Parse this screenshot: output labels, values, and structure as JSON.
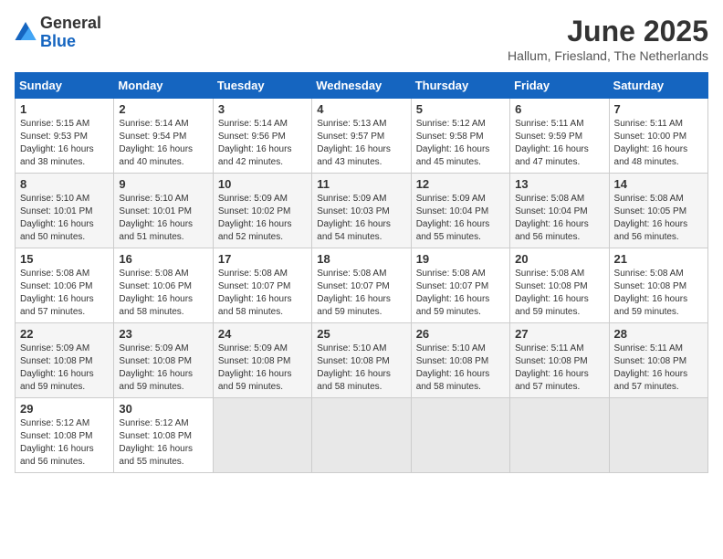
{
  "header": {
    "logo_general": "General",
    "logo_blue": "Blue",
    "month": "June 2025",
    "location": "Hallum, Friesland, The Netherlands"
  },
  "days_of_week": [
    "Sunday",
    "Monday",
    "Tuesday",
    "Wednesday",
    "Thursday",
    "Friday",
    "Saturday"
  ],
  "weeks": [
    [
      {
        "day": 1,
        "sunrise": "5:15 AM",
        "sunset": "9:53 PM",
        "daylight": "16 hours and 38 minutes."
      },
      {
        "day": 2,
        "sunrise": "5:14 AM",
        "sunset": "9:54 PM",
        "daylight": "16 hours and 40 minutes."
      },
      {
        "day": 3,
        "sunrise": "5:14 AM",
        "sunset": "9:56 PM",
        "daylight": "16 hours and 42 minutes."
      },
      {
        "day": 4,
        "sunrise": "5:13 AM",
        "sunset": "9:57 PM",
        "daylight": "16 hours and 43 minutes."
      },
      {
        "day": 5,
        "sunrise": "5:12 AM",
        "sunset": "9:58 PM",
        "daylight": "16 hours and 45 minutes."
      },
      {
        "day": 6,
        "sunrise": "5:11 AM",
        "sunset": "9:59 PM",
        "daylight": "16 hours and 47 minutes."
      },
      {
        "day": 7,
        "sunrise": "5:11 AM",
        "sunset": "10:00 PM",
        "daylight": "16 hours and 48 minutes."
      }
    ],
    [
      {
        "day": 8,
        "sunrise": "5:10 AM",
        "sunset": "10:01 PM",
        "daylight": "16 hours and 50 minutes."
      },
      {
        "day": 9,
        "sunrise": "5:10 AM",
        "sunset": "10:01 PM",
        "daylight": "16 hours and 51 minutes."
      },
      {
        "day": 10,
        "sunrise": "5:09 AM",
        "sunset": "10:02 PM",
        "daylight": "16 hours and 52 minutes."
      },
      {
        "day": 11,
        "sunrise": "5:09 AM",
        "sunset": "10:03 PM",
        "daylight": "16 hours and 54 minutes."
      },
      {
        "day": 12,
        "sunrise": "5:09 AM",
        "sunset": "10:04 PM",
        "daylight": "16 hours and 55 minutes."
      },
      {
        "day": 13,
        "sunrise": "5:08 AM",
        "sunset": "10:04 PM",
        "daylight": "16 hours and 56 minutes."
      },
      {
        "day": 14,
        "sunrise": "5:08 AM",
        "sunset": "10:05 PM",
        "daylight": "16 hours and 56 minutes."
      }
    ],
    [
      {
        "day": 15,
        "sunrise": "5:08 AM",
        "sunset": "10:06 PM",
        "daylight": "16 hours and 57 minutes."
      },
      {
        "day": 16,
        "sunrise": "5:08 AM",
        "sunset": "10:06 PM",
        "daylight": "16 hours and 58 minutes."
      },
      {
        "day": 17,
        "sunrise": "5:08 AM",
        "sunset": "10:07 PM",
        "daylight": "16 hours and 58 minutes."
      },
      {
        "day": 18,
        "sunrise": "5:08 AM",
        "sunset": "10:07 PM",
        "daylight": "16 hours and 59 minutes."
      },
      {
        "day": 19,
        "sunrise": "5:08 AM",
        "sunset": "10:07 PM",
        "daylight": "16 hours and 59 minutes."
      },
      {
        "day": 20,
        "sunrise": "5:08 AM",
        "sunset": "10:08 PM",
        "daylight": "16 hours and 59 minutes."
      },
      {
        "day": 21,
        "sunrise": "5:08 AM",
        "sunset": "10:08 PM",
        "daylight": "16 hours and 59 minutes."
      }
    ],
    [
      {
        "day": 22,
        "sunrise": "5:09 AM",
        "sunset": "10:08 PM",
        "daylight": "16 hours and 59 minutes."
      },
      {
        "day": 23,
        "sunrise": "5:09 AM",
        "sunset": "10:08 PM",
        "daylight": "16 hours and 59 minutes."
      },
      {
        "day": 24,
        "sunrise": "5:09 AM",
        "sunset": "10:08 PM",
        "daylight": "16 hours and 59 minutes."
      },
      {
        "day": 25,
        "sunrise": "5:10 AM",
        "sunset": "10:08 PM",
        "daylight": "16 hours and 58 minutes."
      },
      {
        "day": 26,
        "sunrise": "5:10 AM",
        "sunset": "10:08 PM",
        "daylight": "16 hours and 58 minutes."
      },
      {
        "day": 27,
        "sunrise": "5:11 AM",
        "sunset": "10:08 PM",
        "daylight": "16 hours and 57 minutes."
      },
      {
        "day": 28,
        "sunrise": "5:11 AM",
        "sunset": "10:08 PM",
        "daylight": "16 hours and 57 minutes."
      }
    ],
    [
      {
        "day": 29,
        "sunrise": "5:12 AM",
        "sunset": "10:08 PM",
        "daylight": "16 hours and 56 minutes."
      },
      {
        "day": 30,
        "sunrise": "5:12 AM",
        "sunset": "10:08 PM",
        "daylight": "16 hours and 55 minutes."
      },
      null,
      null,
      null,
      null,
      null
    ]
  ]
}
